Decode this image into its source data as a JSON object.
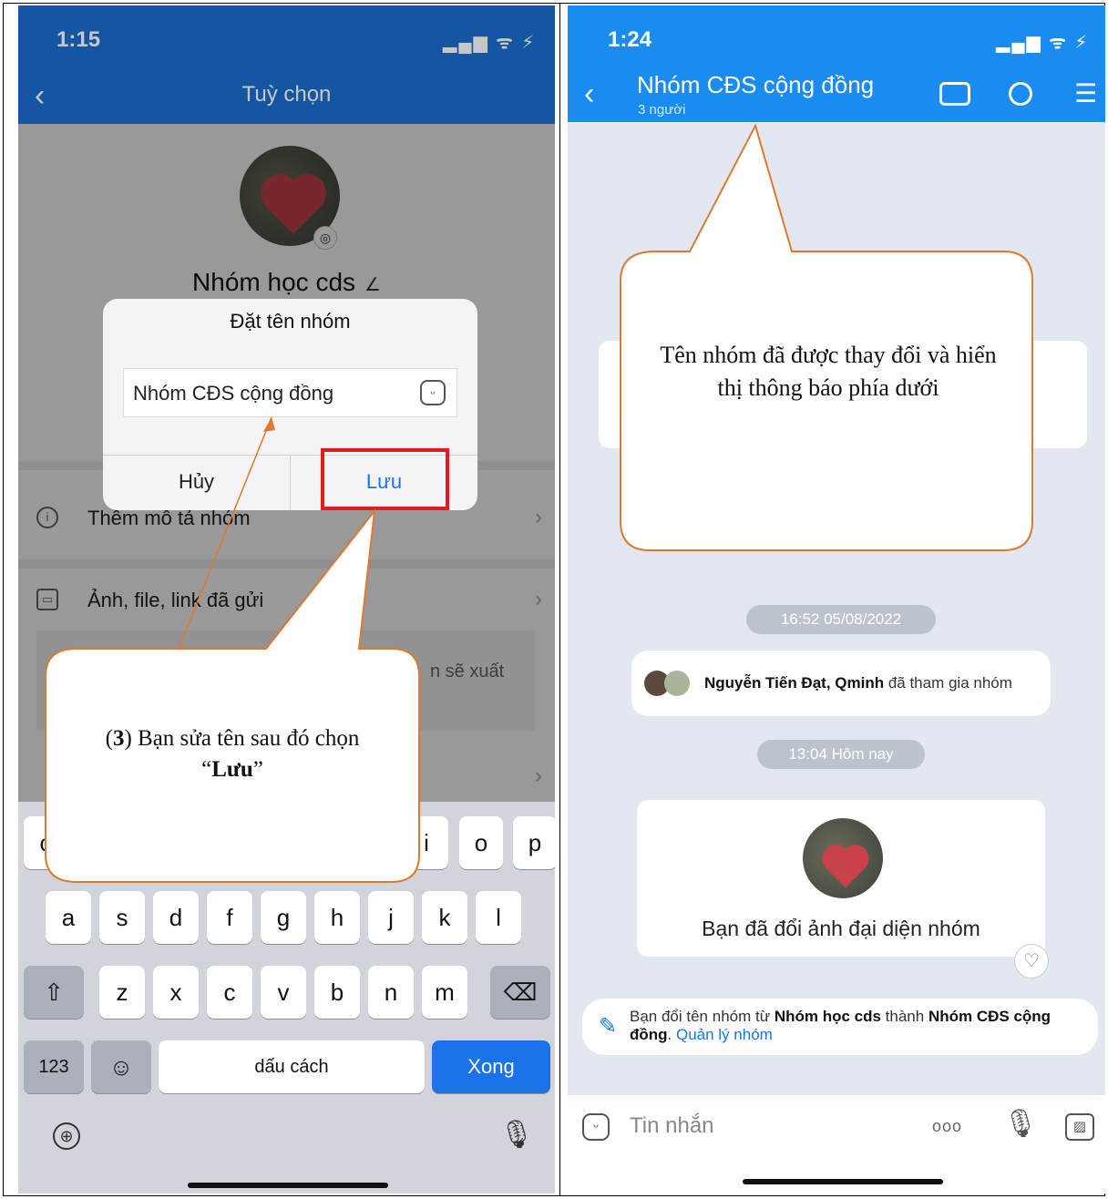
{
  "left": {
    "status_time": "1:15",
    "status_icons": "▂▄▆ ᯤ ⚡",
    "header_title": "Tuỳ chọn",
    "back_glyph": "‹",
    "group_name": "Nhóm học cds",
    "options": [
      {
        "icon": "info-icon",
        "label": "Thêm mô tả nhóm"
      },
      {
        "icon": "gallery-icon",
        "label": "Ảnh, file, link đã gửi"
      }
    ],
    "partial_text": "n sẽ xuất",
    "dialog": {
      "title": "Đặt tên nhóm",
      "input_value": "Nhóm CĐS cộng đồng",
      "cancel_label": "Hủy",
      "save_label": "Lưu"
    },
    "keyboard": {
      "row1_visible": [
        "c",
        "i",
        "o",
        "p"
      ],
      "row2": [
        "a",
        "s",
        "d",
        "f",
        "g",
        "h",
        "j",
        "k",
        "l"
      ],
      "row3": [
        "z",
        "x",
        "c",
        "v",
        "b",
        "n",
        "m"
      ],
      "shift_glyph": "⇧",
      "delete_glyph": "⌫",
      "numbers_label": "123",
      "emoji_glyph": "☺",
      "space_label": "dấu cách",
      "done_label": "Xong"
    },
    "callout": {
      "step": "3",
      "text_before": ") Bạn sửa tên sau đó chọn “",
      "bold": "Lưu",
      "text_after": "”"
    }
  },
  "right": {
    "status_time": "1:24",
    "status_icons": "▂▄▆ ᯤ ⚡",
    "back_glyph": "‹",
    "chat_title": "Nhóm CĐS cộng đồng",
    "member_count": "3 người",
    "callout_text": "Tên nhóm đã được thay đổi và hiển thị thông báo phía dưới",
    "time_pill_1": "16:52 05/08/2022",
    "join_names": "Nguyễn Tiến Đạt, Qminh",
    "join_suffix": " đã tham gia nhóm",
    "time_pill_2": "13:04 Hôm nay",
    "avatar_change_text": "Bạn đã đổi ảnh đại diện nhóm",
    "rename": {
      "prefix": "Bạn đổi tên nhóm từ ",
      "old_name": "Nhóm học cds",
      "middle": " thành ",
      "new_name": "Nhóm CĐS cộng đồng",
      "after": ". ",
      "link": "Quản lý nhóm"
    },
    "input_placeholder": "Tin nhắn",
    "more_glyph": "ooo"
  },
  "colors": {
    "left_header": "#1c6fd1",
    "right_header": "#1a8cf0",
    "accent_blue": "#1a73e8",
    "highlight_red": "#e21b1b",
    "callout_border": "#e0792b"
  }
}
